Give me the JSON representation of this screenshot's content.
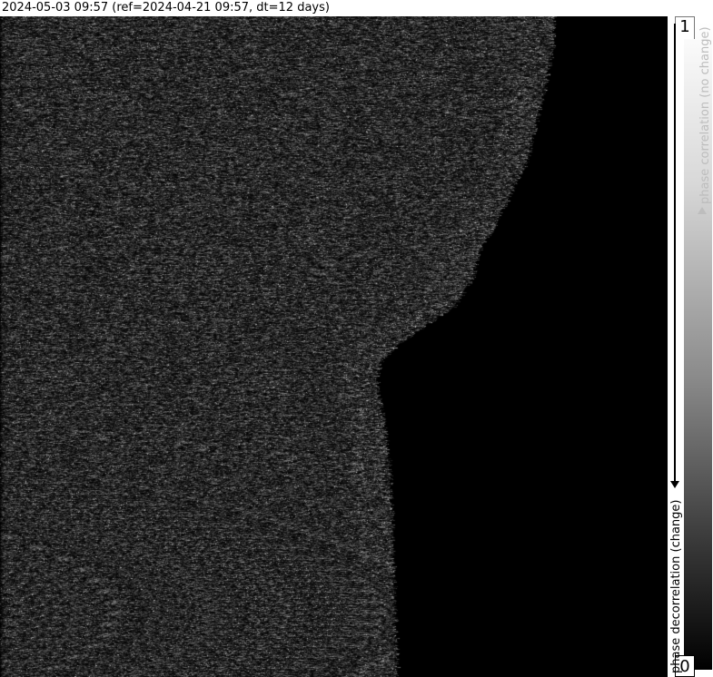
{
  "header": {
    "title": "2024-05-03 09:57 (ref=2024-04-21 09:57, dt=12 days)"
  },
  "legend": {
    "top_value": "1",
    "bottom_value": "0",
    "top_label": "phase correlation (no change)",
    "bottom_label": "phase decorrelation (change)",
    "colors": {
      "top": "#ffffff",
      "bottom": "#000000",
      "top_line": "#bdbdbd",
      "bottom_line": "#000000"
    }
  },
  "map": {
    "background": "#000000",
    "texture": "grayscale-speckle"
  }
}
